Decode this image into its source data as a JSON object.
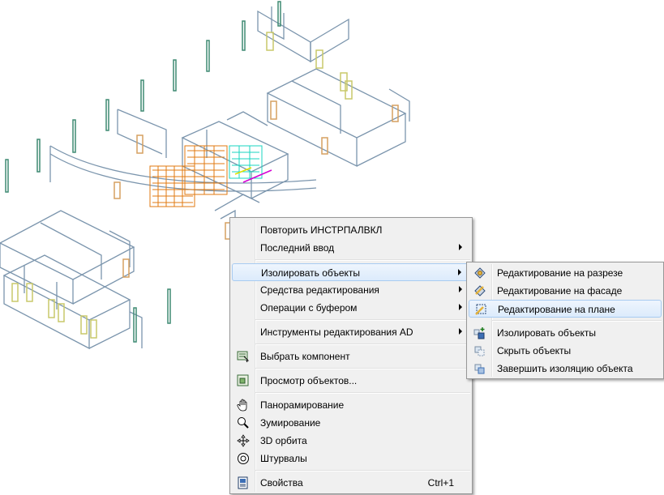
{
  "context_menu": {
    "repeat": "Повторить ИНСТРПАЛВКЛ",
    "recent_input": "Последний ввод",
    "isolate_objects": "Изолировать объекты",
    "editing_tools": "Средства редактирования",
    "clipboard_ops": "Операции с буфером",
    "ad_edit_tools": "Инструменты редактирования AD",
    "select_component": "Выбрать компонент",
    "object_viewer": "Просмотр объектов...",
    "pan": "Панорамирование",
    "zoom": "Зумирование",
    "orbit_3d": "3D орбита",
    "steering_wheels": "Штурвалы",
    "properties": "Свойства",
    "properties_shortcut": "Ctrl+1"
  },
  "submenu": {
    "edit_in_section": "Редактирование на разрезе",
    "edit_in_elevation": "Редактирование на фасаде",
    "edit_in_plan": "Редактирование на плане",
    "isolate_objects": "Изолировать объекты",
    "hide_objects": "Скрыть объекты",
    "end_isolation": "Завершить изоляцию объекта"
  },
  "colors": {
    "wall": "#7b95ad",
    "column": "#3e8a72",
    "door_yellow": "#c9c96a",
    "door_orange": "#d6a060",
    "highlight": "#dcebfc",
    "stair_cyan": "#19d6c2",
    "stair_orange": "#e07a10"
  }
}
